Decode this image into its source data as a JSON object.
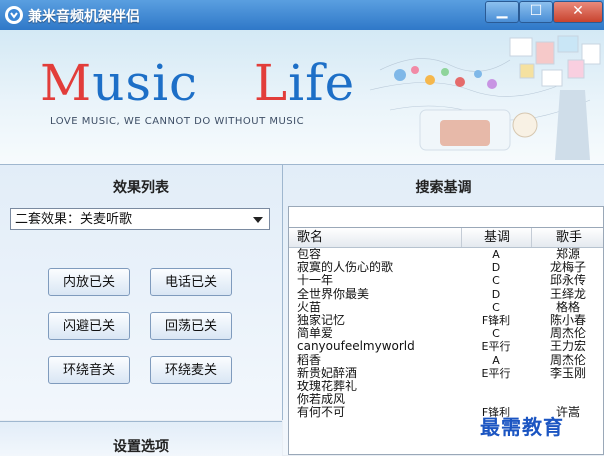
{
  "window": {
    "title": "兼米音频机架伴侣",
    "min_label": "▁",
    "max_label": "☐",
    "close_label": "✕"
  },
  "banner": {
    "logo_m": "M",
    "logo_usic": "usic",
    "logo_l": "L",
    "logo_ife": "ife",
    "tagline": "LOVE MUSIC, WE CANNOT DO WITHOUT MUSIC"
  },
  "effects": {
    "title": "效果列表",
    "selected": "二套效果：关麦听歌",
    "buttons": [
      "内放已关",
      "电话已关",
      "闪避已关",
      "回荡已关",
      "环绕音关",
      "环绕麦关"
    ]
  },
  "settings": {
    "title": "设置选项"
  },
  "search": {
    "title": "搜索基调",
    "value": "",
    "columns": [
      "歌名",
      "基调",
      "歌手"
    ],
    "rows": [
      [
        "包容",
        "A",
        "郑源"
      ],
      [
        "寂寞的人伤心的歌",
        "D",
        "龙梅子"
      ],
      [
        "十一年",
        "C",
        "邱永传"
      ],
      [
        "全世界你最美",
        "D",
        "王绎龙"
      ],
      [
        "火苗",
        "C",
        "格格"
      ],
      [
        "独家记忆",
        "F锋利",
        "陈小春"
      ],
      [
        "简单爱",
        "C",
        "周杰伦"
      ],
      [
        "canyoufeelmyworld",
        "E平行",
        "王力宏"
      ],
      [
        "稻香",
        "A",
        "周杰伦"
      ],
      [
        "新贵妃醉酒",
        "E平行",
        "李玉刚"
      ],
      [
        "玫瑰花葬礼",
        "",
        ""
      ],
      [
        "你若成风",
        "",
        ""
      ],
      [
        "有何不可",
        "F锋利",
        "许嵩"
      ]
    ]
  },
  "watermark": "最需教育",
  "colors": {
    "titlebar": "#2f78c8",
    "logo_red": "#e23d3a",
    "logo_blue": "#1d6fc7",
    "watermark": "#1b55c2"
  }
}
